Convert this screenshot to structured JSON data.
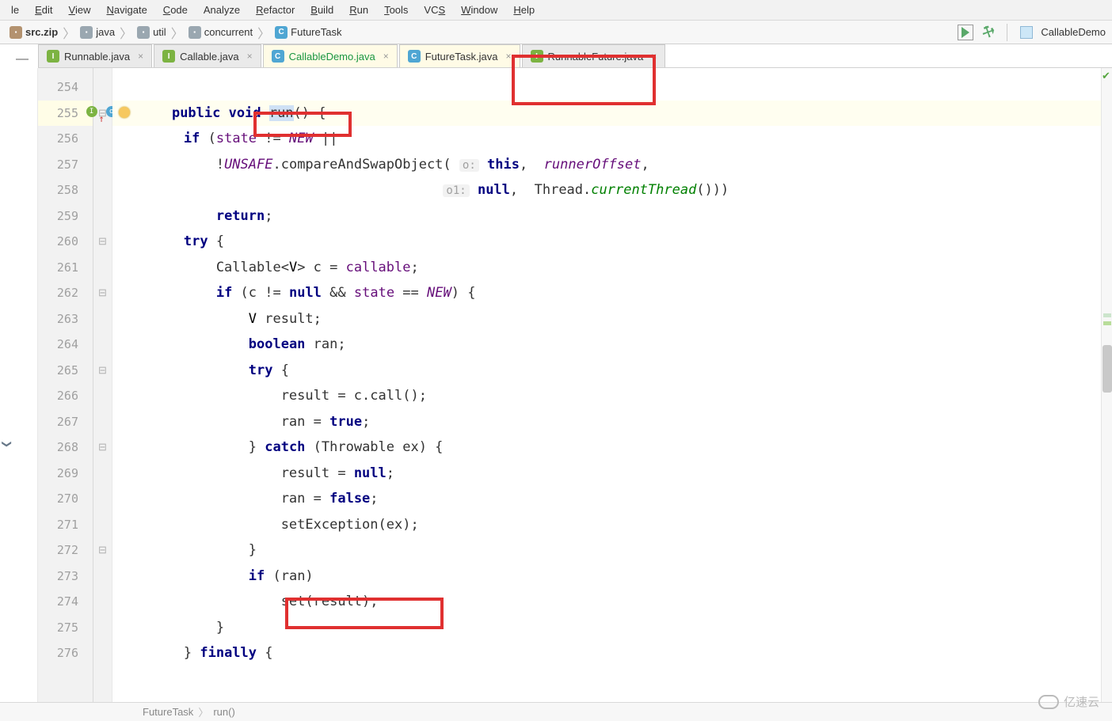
{
  "menu": [
    "le",
    "Edit",
    "View",
    "Navigate",
    "Code",
    "Analyze",
    "Refactor",
    "Build",
    "Run",
    "Tools",
    "VCS",
    "Window",
    "Help"
  ],
  "menu_underline_idx": [
    -1,
    0,
    0,
    0,
    0,
    -1,
    0,
    0,
    0,
    0,
    2,
    0,
    0
  ],
  "breadcrumb": {
    "items": [
      {
        "icon": "jar",
        "label": "src.zip"
      },
      {
        "icon": "folder",
        "label": "java"
      },
      {
        "icon": "folder",
        "label": "util"
      },
      {
        "icon": "folder",
        "label": "concurrent"
      },
      {
        "icon": "class",
        "label": "FutureTask"
      }
    ]
  },
  "run_config": "CallableDemo",
  "tabs": [
    {
      "icon": "interface",
      "label": "Runnable.java",
      "style": "normal"
    },
    {
      "icon": "interface",
      "label": "Callable.java",
      "style": "normal"
    },
    {
      "icon": "class",
      "label": "CallableDemo.java",
      "style": "green"
    },
    {
      "icon": "class",
      "label": "FutureTask.java",
      "style": "active"
    },
    {
      "icon": "interface",
      "label": "RunnableFuture.java",
      "style": "normal"
    }
  ],
  "line_start": 254,
  "lines": [
    {
      "n": 254,
      "html": ""
    },
    {
      "n": 255,
      "html": "    <span class='kw'>public</span> <span class='kw'>void</span> <span class='sel-highlight'>run</span>() {",
      "sig": true,
      "bulb": true
    },
    {
      "n": 256,
      "html": "        <span class='kw'>if</span> (<span class='field'>state</span> != <span class='const-italic'>NEW</span> ||"
    },
    {
      "n": 257,
      "html": "            !<span class='const-italic'>UNSAFE</span>.compareAndSwapObject( <span class='hint'>o:</span> <span class='kw'>this</span>,  <span class='const-italic'>runnerOffset</span>,"
    },
    {
      "n": 258,
      "html": "                                        <span class='hint'>o1:</span> <span class='kw'>null</span>,  Thread.<span class='method-green'>currentThread</span>()))"
    },
    {
      "n": 259,
      "html": "            <span class='kw'>return</span>;"
    },
    {
      "n": 260,
      "html": "        <span class='kw'>try</span> {"
    },
    {
      "n": 261,
      "html": "            Callable&lt;<span class='type'>V</span>&gt; c = <span class='field'>callable</span>;"
    },
    {
      "n": 262,
      "html": "            <span class='kw'>if</span> (c != <span class='kw'>null</span> &amp;&amp; <span class='field'>state</span> == <span class='const-italic'>NEW</span>) {"
    },
    {
      "n": 263,
      "html": "                <span class='type'>V</span> result;"
    },
    {
      "n": 264,
      "html": "                <span class='kw'>boolean</span> ran;"
    },
    {
      "n": 265,
      "html": "                <span class='kw'>try</span> {"
    },
    {
      "n": 266,
      "html": "                    result = c.call();"
    },
    {
      "n": 267,
      "html": "                    ran = <span class='kw'>true</span>;"
    },
    {
      "n": 268,
      "html": "                } <span class='kw'>catch</span> (Throwable ex) {"
    },
    {
      "n": 269,
      "html": "                    result = <span class='kw'>null</span>;"
    },
    {
      "n": 270,
      "html": "                    ran = <span class='kw'>false</span>;"
    },
    {
      "n": 271,
      "html": "                    setException(ex);"
    },
    {
      "n": 272,
      "html": "                }"
    },
    {
      "n": 273,
      "html": "                <span class='kw'>if</span> (ran)"
    },
    {
      "n": 274,
      "html": "                    set(result);"
    },
    {
      "n": 275,
      "html": "            }"
    },
    {
      "n": 276,
      "html": "        } <span class='kw'>finally</span> {"
    }
  ],
  "status": {
    "class": "FutureTask",
    "method": "run()"
  },
  "watermark": "亿速云"
}
